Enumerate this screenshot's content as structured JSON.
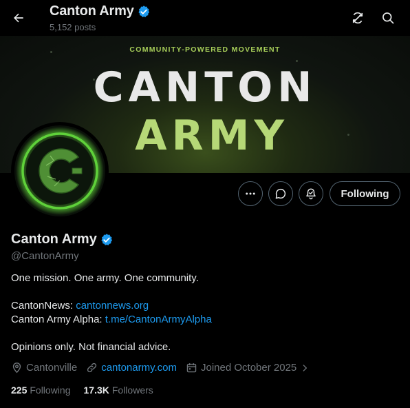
{
  "header": {
    "title": "Canton Army",
    "posts_count": "5,152 posts"
  },
  "banner": {
    "tagline": "COMMUNITY-POWERED MOVEMENT",
    "line1": "CANTON",
    "line2": "ARMY"
  },
  "actions": {
    "following_label": "Following"
  },
  "profile": {
    "name": "Canton Army",
    "handle": "@CantonArmy",
    "bio": {
      "line1": "One mission. One army. One community.",
      "news_label": "CantonNews:",
      "news_link": "cantonnews.org",
      "alpha_label": "Canton Army Alpha:",
      "alpha_link": "t.me/CantonArmyAlpha",
      "disclaimer": "Opinions only. Not financial advice."
    },
    "location": "Cantonville",
    "website": "cantonarmy.com",
    "joined": "Joined October 2025",
    "following_count": "225",
    "following_label": "Following",
    "followers_count": "17.3K",
    "followers_label": "Followers"
  },
  "colors": {
    "background": "#000000",
    "accent": "#1d9bf0",
    "verified": "#1d9bf0",
    "banner_green": "#b6d877",
    "avatar_green": "#5fd13a",
    "muted": "#71767b"
  },
  "icons": [
    "back-arrow-icon",
    "verified-badge-icon",
    "refresh-icon",
    "search-icon",
    "more-icon",
    "message-icon",
    "notification-bell-icon",
    "location-icon",
    "link-icon",
    "calendar-icon",
    "chevron-right-icon"
  ]
}
